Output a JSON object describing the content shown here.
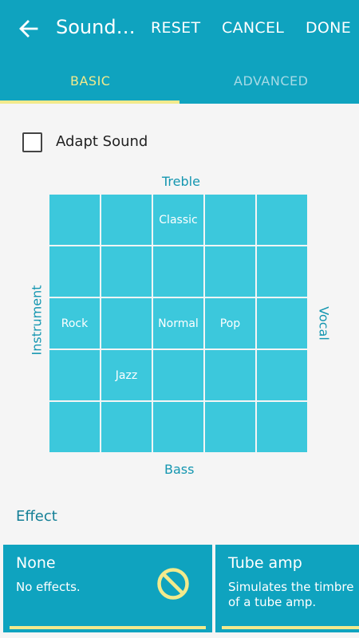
{
  "header": {
    "title": "Sound…",
    "reset_label": "RESET",
    "cancel_label": "CANCEL",
    "done_label": "DONE"
  },
  "tabs": {
    "basic": "BASIC",
    "advanced": "ADVANCED",
    "selected": "BASIC"
  },
  "adapt_sound": {
    "label": "Adapt Sound",
    "checked": false
  },
  "equalizer": {
    "top_label": "Treble",
    "bottom_label": "Bass",
    "left_label": "Instrument",
    "right_label": "Vocal",
    "cells": [
      [
        "",
        "",
        "Classic",
        "",
        ""
      ],
      [
        "",
        "",
        "",
        "",
        ""
      ],
      [
        "Rock",
        "",
        "Normal",
        "Pop",
        ""
      ],
      [
        "",
        "Jazz",
        "",
        "",
        ""
      ],
      [
        "",
        "",
        "",
        "",
        ""
      ]
    ]
  },
  "effect": {
    "section_label": "Effect",
    "cards": [
      {
        "title": "None",
        "description": "No effects.",
        "icon": "no-effect-icon",
        "selected": true
      },
      {
        "title": "Tube amp",
        "description": "Simulates the timbre of a tube amp.",
        "selected": false
      }
    ]
  },
  "colors": {
    "accent": "#0fa3bf",
    "indicator": "#f2ea8c",
    "grid_cell": "#3cc8dc"
  }
}
